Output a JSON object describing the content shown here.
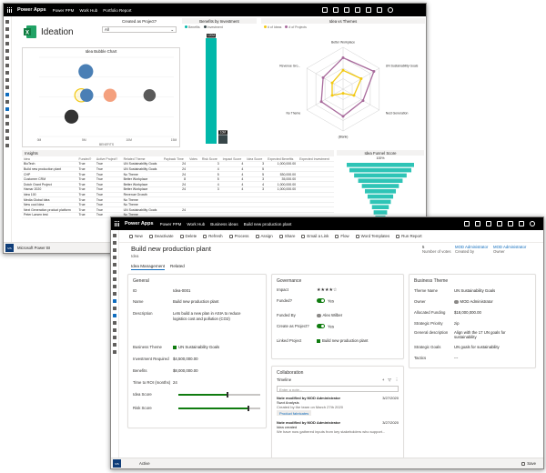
{
  "win1": {
    "topbar": {
      "app": "Power Apps",
      "crumbs": [
        "Power PPM",
        "Work Hub",
        "Portfolio Report"
      ]
    },
    "ideation_title": "Ideation",
    "slicer": {
      "title": "Created as Project?",
      "value": "All"
    },
    "bubble_title": "Idea Bubble Chart",
    "bubble_xlabel": "BENEFITS",
    "bubble_xticks": [
      "0M",
      "5M",
      "10M",
      "15M"
    ],
    "benefits_title": "Benefits by Investment",
    "benefits_legend": [
      "Benefits",
      "Investment"
    ],
    "benefits_labels": [
      "120M",
      "10M"
    ],
    "radar_title": "Idea vs Themes",
    "radar_legend": [
      "# of Ideas",
      "# of Projects"
    ],
    "radar_axes": [
      "Better Workplace",
      "UN Sustainability Goals",
      "Nest Generation",
      "(Blank)",
      "No Theme",
      "Revenue Gro..."
    ],
    "insights_title": "Insights",
    "funnel_title": "Idea Funnel Score",
    "funnel_top": "100%",
    "footer_label": "Microsoft Power BI",
    "chart_data": [
      {
        "type": "scatter",
        "title": "Idea Bubble Chart",
        "xlabel": "BENEFITS",
        "ylabel": "",
        "xlim": [
          0,
          15
        ],
        "points": [
          {
            "x": 5.2,
            "y": 0.82,
            "size": 0.9,
            "color": "#4a7fb5"
          },
          {
            "x": 4.7,
            "y": 0.52,
            "size": 0.8,
            "color": "#f2c811"
          },
          {
            "x": 5.3,
            "y": 0.52,
            "size": 0.8,
            "color": "#4a7fb5"
          },
          {
            "x": 7.9,
            "y": 0.52,
            "size": 0.8,
            "color": "#f4a07e"
          },
          {
            "x": 12.3,
            "y": 0.52,
            "size": 0.75,
            "color": "#5a5a5a"
          },
          {
            "x": 3.6,
            "y": 0.25,
            "size": 0.85,
            "color": "#333333"
          }
        ]
      },
      {
        "type": "bar",
        "title": "Benefits by Investment",
        "categories": [
          "Benefits",
          "Investment"
        ],
        "values": [
          120,
          10
        ],
        "data_labels": [
          "120M",
          "10M"
        ]
      },
      {
        "type": "radar",
        "title": "Idea vs Themes",
        "categories": [
          "Better Workplace",
          "UN Sustainability Goals",
          "Nest Generation",
          "(Blank)",
          "No Theme",
          "Revenue Gro..."
        ],
        "series": [
          {
            "name": "# of Ideas",
            "color": "#f2c811",
            "values": [
              0.45,
              0.5,
              0.3,
              0.1,
              0.3,
              0.3
            ]
          },
          {
            "name": "# of Projects",
            "color": "#a86a9c",
            "values": [
              0.75,
              0.85,
              0.55,
              0.65,
              0.6,
              0.55
            ]
          }
        ]
      },
      {
        "type": "funnel",
        "title": "Idea Funnel Score",
        "top_label": "100%",
        "values": [
          100,
          92,
          78,
          66,
          55,
          46,
          38,
          31,
          25,
          20,
          15,
          11,
          7
        ]
      }
    ],
    "insights": {
      "columns": [
        "Idea",
        "Funded?",
        "Active Project?",
        "Related Theme",
        "Payback Time",
        "Votes",
        "Risk Score",
        "Impact Score",
        "Idea Score",
        "Expected Benefits",
        "Expected Investment"
      ],
      "rows": [
        [
          "BioTech",
          "True",
          "True",
          "UN Sustainability Goals",
          "24",
          "",
          "3",
          "4",
          "3",
          "1,000,000.00",
          ""
        ],
        [
          "Build new production plant",
          "True",
          "True",
          "UN Sustainability Goals",
          "24",
          "",
          "4",
          "4",
          "5",
          "",
          ""
        ],
        [
          "CHP",
          "True",
          "True",
          "No Theme",
          "24",
          "",
          "5",
          "4",
          "5",
          "530,000.00",
          ""
        ],
        [
          "Customer CRM",
          "True",
          "True",
          "Better Workplace",
          "8",
          "",
          "5",
          "4",
          "3",
          "35,000.00",
          ""
        ],
        [
          "Dutch Grant Project",
          "True",
          "True",
          "Better Workplace",
          "24",
          "",
          "4",
          "4",
          "4",
          "1,000,000.00",
          ""
        ],
        [
          "Hamar 2020",
          "True",
          "True",
          "Better Workplace",
          "24",
          "",
          "3",
          "4",
          "3",
          "1,000,000.00",
          ""
        ],
        [
          "Idea 100",
          "True",
          "True",
          "Revenue Growth",
          "",
          "",
          "",
          "",
          "",
          "",
          ""
        ],
        [
          "Media Global Idea",
          "True",
          "True",
          "No Theme",
          "",
          "",
          "",
          "",
          "",
          "",
          ""
        ],
        [
          "New cool Idea",
          "True",
          "True",
          "No Theme",
          "",
          "",
          "",
          "",
          "",
          "",
          ""
        ],
        [
          "Next Generation product platform",
          "True",
          "True",
          "UN Sustainability Goals",
          "24",
          "",
          "",
          "",
          "",
          "",
          ""
        ],
        [
          "Peter Larsen test",
          "True",
          "True",
          "No Theme",
          "",
          "",
          "",
          "",
          "",
          "",
          ""
        ]
      ]
    }
  },
  "win2": {
    "topbar": {
      "app": "Power Apps",
      "crumbs": [
        "Power PPM",
        "Work Hub",
        "Business ideas",
        "Build new production plant"
      ]
    },
    "commands": [
      "New",
      "Deactivate",
      "Delete",
      "Refresh",
      "Process",
      "Assign",
      "Share",
      "Email a Link",
      "Flow",
      "Word Templates",
      "Run Report"
    ],
    "header": {
      "title": "Build new production plant",
      "entity": "Idea",
      "votes_value": "5",
      "votes_label": "Number of votes",
      "created_by_value": "MOD Administrator",
      "created_by_label": "Created by",
      "owner_value": "MOD Administrator",
      "owner_label": "Owner"
    },
    "tabs": [
      "Idea Management",
      "Related"
    ],
    "general": {
      "title": "General",
      "id_label": "ID",
      "id_value": "Idea-0001",
      "name_label": "Name",
      "name_value": "Build new production plant",
      "desc_label": "Description",
      "desc_value": "Lets build a new plan in ASIA to reduce logistics cost and pollution (CO2)",
      "theme_label": "Business Theme",
      "theme_value": "UN Sustainability Goals",
      "inv_label": "Investment Required",
      "inv_value": "$4,500,000.00",
      "benefits_label": "Benefits",
      "benefits_value": "$8,000,000.00",
      "roi_label": "Time to ROI (months)",
      "roi_value": "24",
      "ideascore_label": "Idea Score",
      "ideascore_value": 0.6,
      "risk_label": "Risk Score",
      "risk_value": 0.85
    },
    "governance": {
      "title": "Governance",
      "impact_label": "Impact",
      "impact_stars": "★★★★☆",
      "funded_label": "Funded?",
      "funded_value": "Yes",
      "fundedby_label": "Funded By",
      "fundedby_value": "Alex Wilber",
      "created_label": "Create as Project?",
      "created_value": "Yes",
      "linked_label": "Linked Project",
      "linked_value": "Build new production plant"
    },
    "collaboration": {
      "title": "Collaboration",
      "timeline_label": "Timeline",
      "note_placeholder": "Enter a note...",
      "posts": [
        {
          "title": "Note modified by MOD Administrator",
          "sub": "Swot Analysis",
          "text": "Created by the team on March 27th 2020",
          "date": "3/27/2020",
          "attachment": "Product fabricates"
        },
        {
          "title": "Note modified by MOD Administrator",
          "sub": "Idea created",
          "text": "We have now gathered inputs from key stakeholders who support...",
          "date": "3/27/2020"
        }
      ]
    },
    "theme": {
      "title": "Business Theme",
      "name_label": "Theme Name",
      "name_value": "UN Sustainability Goals",
      "owner_label": "Owner",
      "owner_value": "MOD Administrator",
      "funding_label": "Allocated Funding",
      "funding_value": "$18,000,000.00",
      "priority_label": "Strategic Priority",
      "priority_value": "zip",
      "gen_label": "General description",
      "gen_value": "Align with the 17 UN goals for sustainability",
      "goals_label": "Strategic Goals",
      "goals_value": "UN goals for sustainability",
      "tactics_label": "Tactics",
      "tactics_value": "---"
    },
    "footer": {
      "status": "Active",
      "save": "Save"
    }
  }
}
